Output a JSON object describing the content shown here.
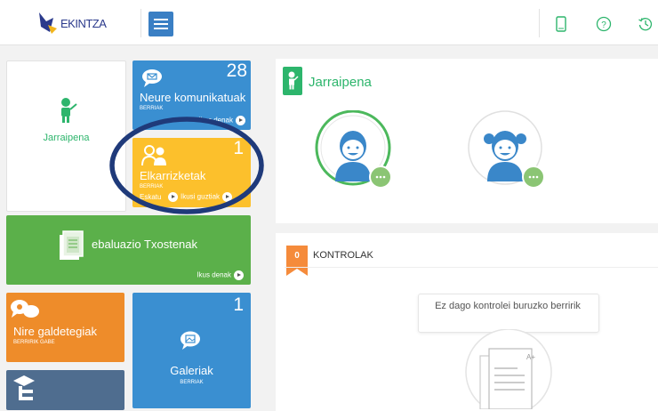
{
  "header": {
    "logo_text": "EKINTZA",
    "icons": [
      "tablet-icon",
      "help-icon",
      "history-icon"
    ]
  },
  "tiles": {
    "jarraipena": {
      "label": "Jarraipena"
    },
    "messages": {
      "count": "28",
      "title": "Neure komunikatuak",
      "sub": "BERRIAK",
      "link": "Ikus denak"
    },
    "interviews": {
      "count": "1",
      "title": "Elkarrizketak",
      "sub": "BERRIAK",
      "link_left": "Eskatu",
      "link_right": "Ikusi guztiak"
    },
    "reports": {
      "title": "ebaluazio Txostenak",
      "link": "Ikus denak"
    },
    "surveys": {
      "title": "Nire galdetegiak",
      "sub": "BERRIRIK GABE"
    },
    "gallery": {
      "count": "1",
      "title": "Galeriak",
      "sub": "BERRIAK"
    }
  },
  "panel": {
    "title": "Jarraipena",
    "kontrolak_count": "0",
    "kontrolak_title": "KONTROLAK",
    "empty_message": "Ez dago kontrolei buruzko berririk"
  },
  "colors": {
    "blue": "#3a8fd1",
    "yellow": "#fcc02c",
    "green": "#5bb04a",
    "orange": "#ee8c2a",
    "slate": "#4f6d8f",
    "accent_green": "#2db56c",
    "annotation_ring": "#1f3a7a"
  }
}
